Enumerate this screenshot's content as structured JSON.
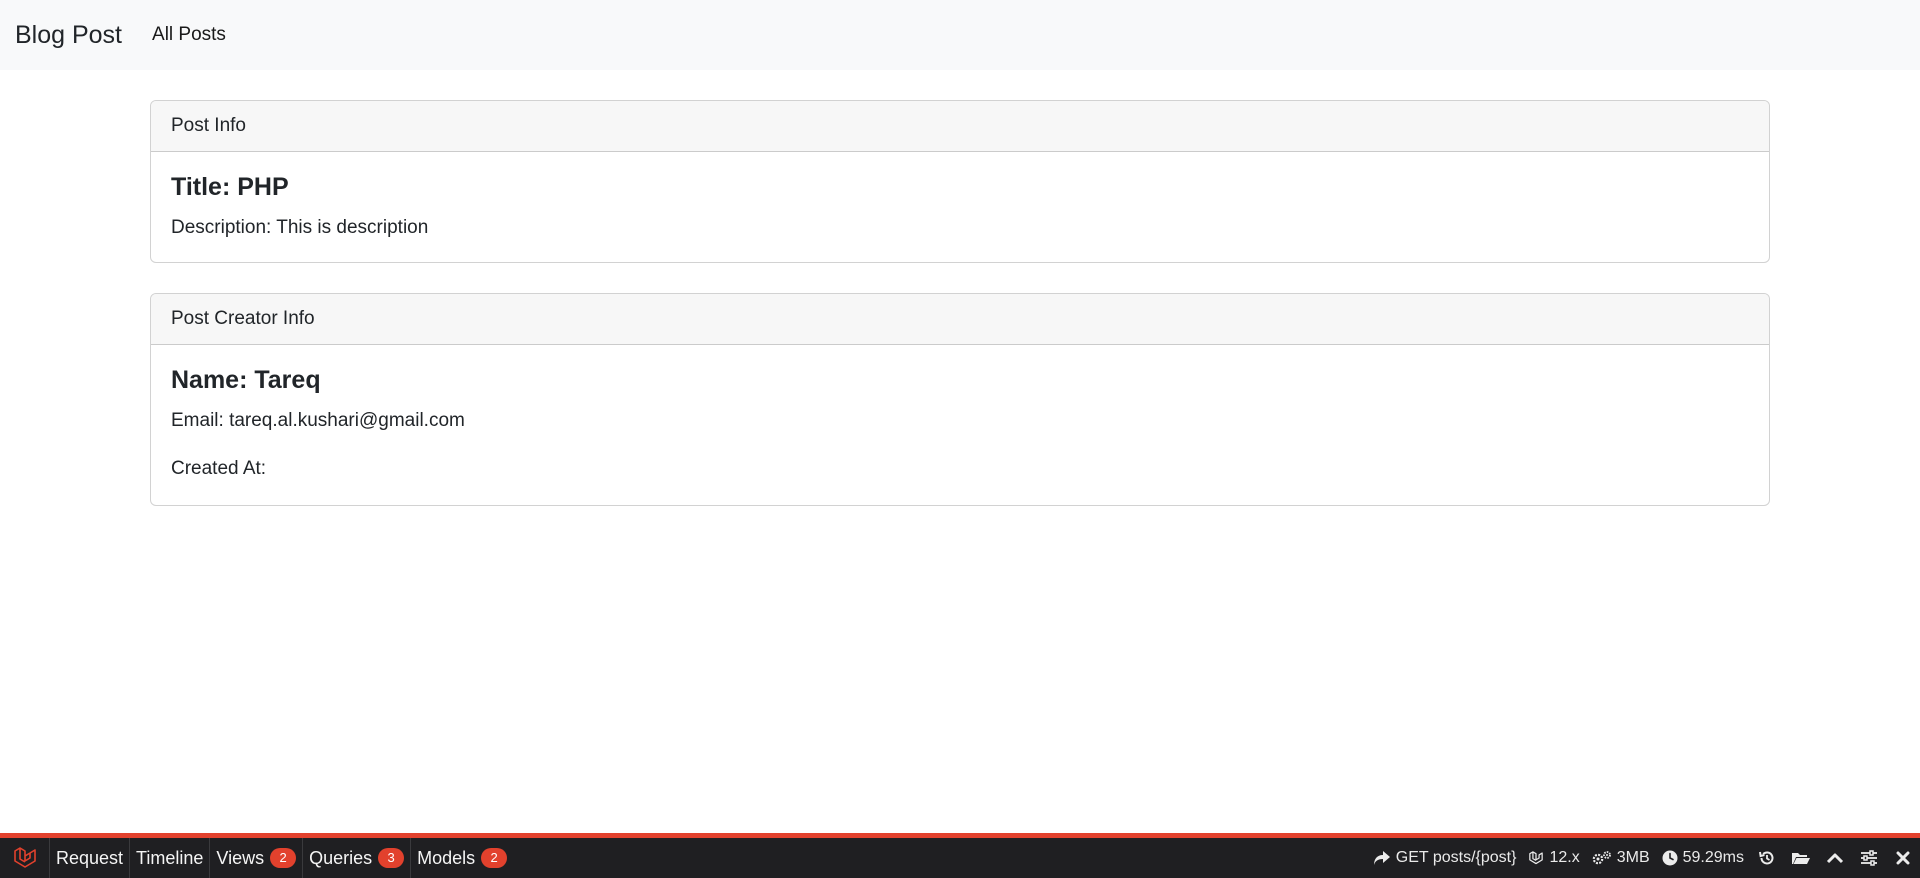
{
  "navbar": {
    "brand": "Blog Post",
    "links": [
      "All Posts"
    ]
  },
  "post_card": {
    "header": "Post Info",
    "title": "Title: PHP",
    "description": "Description: This is description"
  },
  "creator_card": {
    "header": "Post Creator Info",
    "name": "Name: Tareq",
    "email": "Email: tareq.al.kushari@gmail.com",
    "created_at": "Created At:"
  },
  "debugbar": {
    "accent": "#e2412d",
    "tabs": [
      {
        "label": "Request"
      },
      {
        "label": "Timeline"
      },
      {
        "label": "Views",
        "badge": "2"
      },
      {
        "label": "Queries",
        "badge": "3"
      },
      {
        "label": "Models",
        "badge": "2"
      }
    ],
    "route": "GET posts/{post}",
    "version": "12.x",
    "memory": "3MB",
    "duration": "59.29ms",
    "icons": [
      "laravel-logo-icon",
      "share-arrow-icon",
      "laravel-icon",
      "gears-icon",
      "clock-icon",
      "history-icon",
      "folder-open-icon",
      "chevron-up-icon",
      "sliders-icon",
      "close-icon"
    ]
  }
}
